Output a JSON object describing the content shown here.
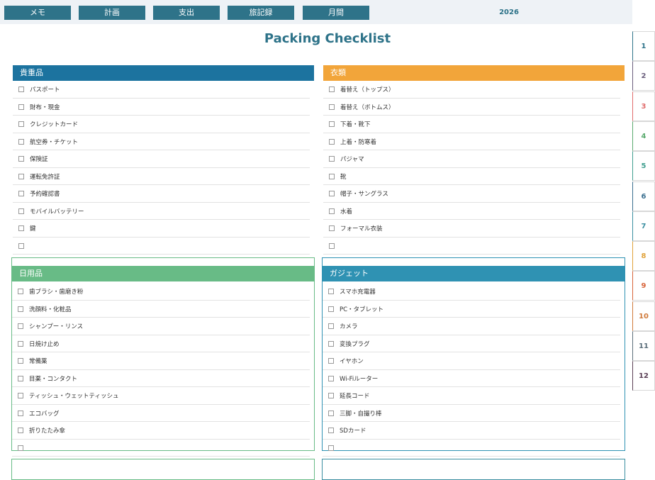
{
  "nav": {
    "tabs": [
      {
        "label": "メモ"
      },
      {
        "label": "計画"
      },
      {
        "label": "支出"
      },
      {
        "label": "旅記録"
      },
      {
        "label": "月間"
      }
    ],
    "year": "2026"
  },
  "page": {
    "title": "Packing Checklist"
  },
  "panels": [
    {
      "title": "貴重品",
      "color": "#1c739f",
      "items": [
        "パスポート",
        "財布・現金",
        "クレジットカード",
        "航空券・チケット",
        "保険証",
        "運転免許証",
        "予約確認書",
        "モバイルバッテリー",
        "鍵",
        ""
      ]
    },
    {
      "title": "衣類",
      "color": "#f2a53a",
      "items": [
        "着替え（トップス）",
        "着替え（ボトムス）",
        "下着・靴下",
        "上着・防寒着",
        "パジャマ",
        "靴",
        "帽子・サングラス",
        "水着",
        "フォーマル衣装",
        ""
      ]
    },
    {
      "title": "日用品",
      "color": "#68bb86",
      "items": [
        "歯ブラシ・歯磨き粉",
        "洗顔料・化粧品",
        "シャンプー・リンス",
        "日焼け止め",
        "常備薬",
        "目薬・コンタクト",
        "ティッシュ・ウェットティッシュ",
        "エコバッグ",
        "折りたたみ傘",
        ""
      ]
    },
    {
      "title": "ガジェット",
      "color": "#2f92b3",
      "items": [
        "スマホ充電器",
        "PC・タブレット",
        "カメラ",
        "変換プラグ",
        "イヤホン",
        "Wi-Fiルーター",
        "延長コード",
        "三脚・自撮り棒",
        "SDカード",
        ""
      ]
    }
  ],
  "months": [
    {
      "label": "1",
      "color": "#2e7389"
    },
    {
      "label": "2",
      "color": "#6a5e7c"
    },
    {
      "label": "3",
      "color": "#e06b6b"
    },
    {
      "label": "4",
      "color": "#5aaa6e"
    },
    {
      "label": "5",
      "color": "#3f9e8e"
    },
    {
      "label": "6",
      "color": "#3a6f8f"
    },
    {
      "label": "7",
      "color": "#3a8ea0"
    },
    {
      "label": "8",
      "color": "#e0a23a"
    },
    {
      "label": "9",
      "color": "#d8643a"
    },
    {
      "label": "10",
      "color": "#d07a3a"
    },
    {
      "label": "11",
      "color": "#5b6e7a"
    },
    {
      "label": "12",
      "color": "#5a3f55"
    }
  ]
}
